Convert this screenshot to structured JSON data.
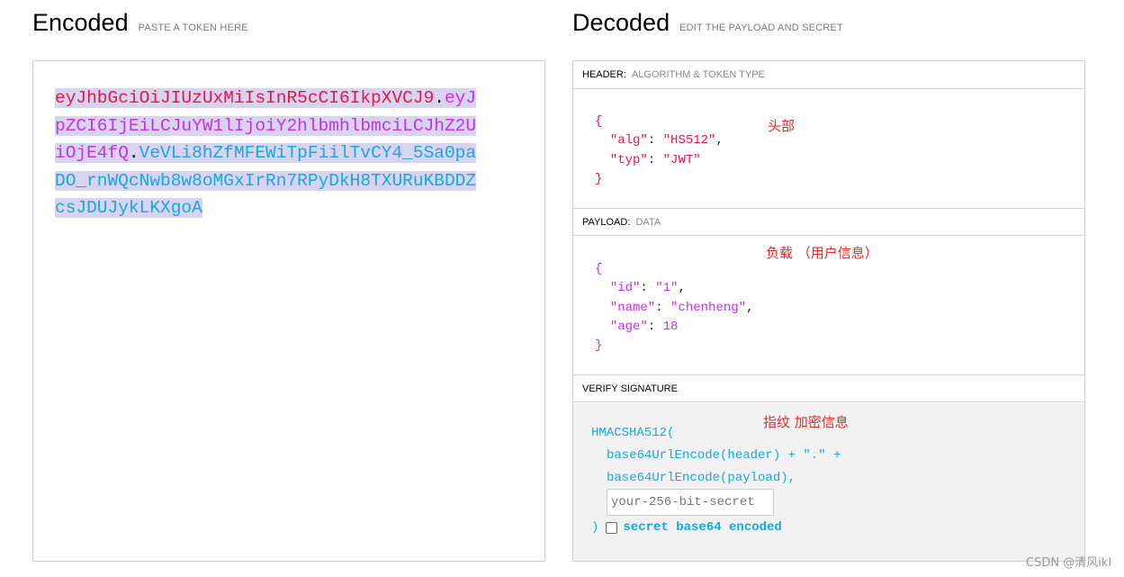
{
  "encoded": {
    "title": "Encoded",
    "subtitle": "PASTE A TOKEN HERE",
    "token_header": "eyJhbGciOiJIUzUxMiIsInR5cCI6IkpXVCJ9",
    "dot": ".",
    "token_payload": "eyJpZCI6IjEiLCJuYW1lIjoiY2hlbmhlbmciLCJhZ2UiOjE4fQ",
    "token_signature": "VeVLi8hZfMFEWiTpFiilTvCY4_5Sa0paDO_rnWQcNwb8w8oMGxIrRn7RPyDkH8TXURuKBDDZcsJDUJykLKXgoA"
  },
  "decoded": {
    "title": "Decoded",
    "subtitle": "EDIT THE PAYLOAD AND SECRET",
    "header_section": {
      "label": "HEADER:",
      "sublabel": "ALGORITHM & TOKEN TYPE",
      "open_brace": "{",
      "close_brace": "}",
      "lines": [
        {
          "key": "\"alg\"",
          "sep": ": ",
          "value": "\"HS512\"",
          "tail": ","
        },
        {
          "key": "\"typ\"",
          "sep": ": ",
          "value": "\"JWT\"",
          "tail": ""
        }
      ],
      "note": "头部"
    },
    "payload_section": {
      "label": "PAYLOAD:",
      "sublabel": "DATA",
      "open_brace": "{",
      "close_brace": "}",
      "lines": [
        {
          "key": "\"id\"",
          "sep": ": ",
          "value": "\"1\"",
          "tail": ","
        },
        {
          "key": "\"name\"",
          "sep": ": ",
          "value": "\"chenheng\"",
          "tail": ","
        },
        {
          "key": "\"age\"",
          "sep": ": ",
          "value": "18",
          "tail": ""
        }
      ],
      "note": "负载 （用户信息）"
    },
    "signature_section": {
      "label": "VERIFY SIGNATURE",
      "note": "指纹 加密信息",
      "line1": "HMACSHA512(",
      "line2": "base64UrlEncode(header) + \".\" +",
      "line3": "base64UrlEncode(payload),",
      "secret_placeholder": "your-256-bit-secret",
      "close_paren": ")",
      "checkbox_label": "secret base64 encoded",
      "checkbox_checked": false
    }
  },
  "colors": {
    "header": "#e5174f",
    "payload": "#c631e6",
    "signature": "#16a8df",
    "annotation": "#e02b2b"
  },
  "watermark": "CSDN @清风ikl"
}
